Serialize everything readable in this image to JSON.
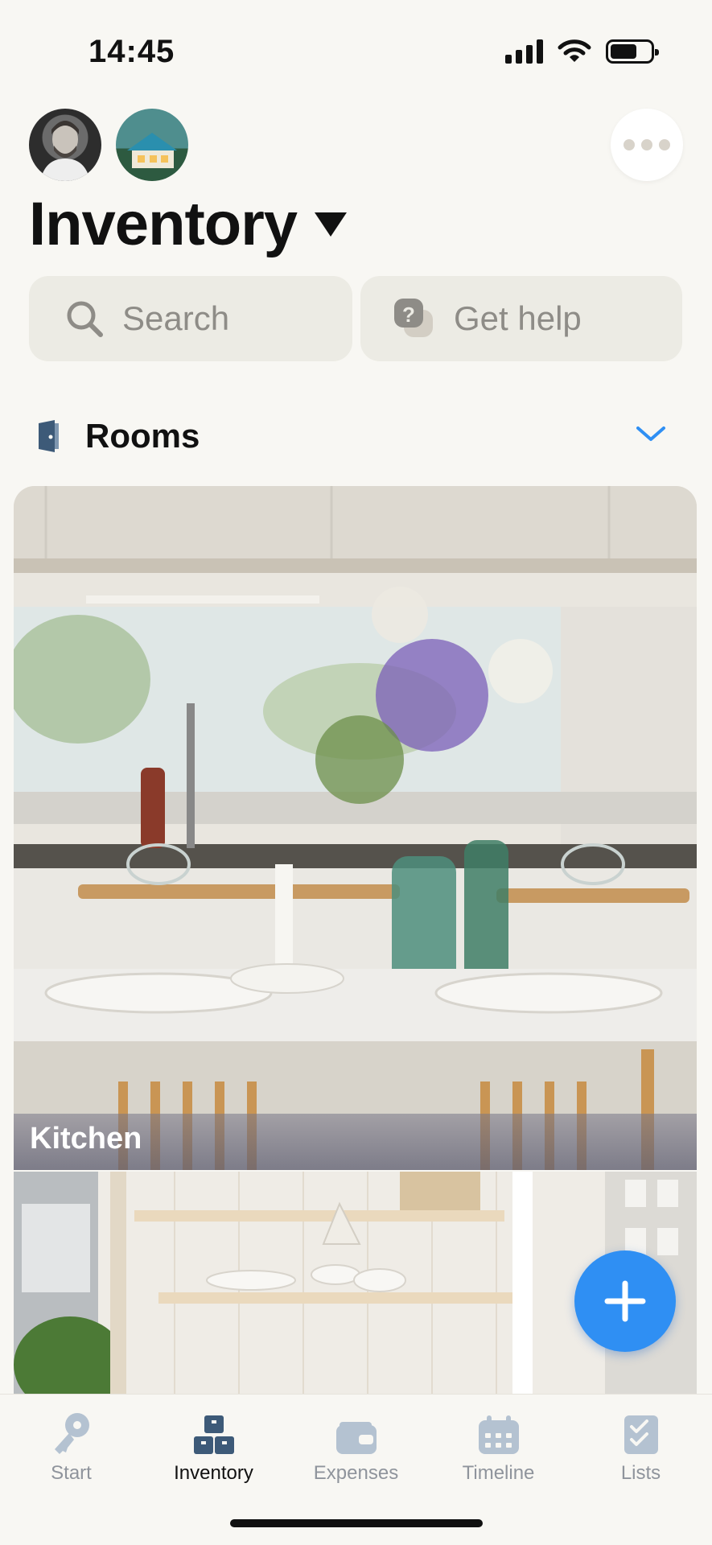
{
  "status_bar": {
    "time": "14:45"
  },
  "header": {
    "title": "Inventory",
    "more_icon": "ellipsis-icon"
  },
  "actions": {
    "search_label": "Search",
    "help_label": "Get help"
  },
  "rooms": {
    "section_label": "Rooms",
    "items": [
      {
        "name": "Kitchen"
      },
      {
        "name": ""
      }
    ]
  },
  "fab": {
    "icon": "plus-icon"
  },
  "tab_bar": {
    "active": "Inventory",
    "items": [
      {
        "label": "Start",
        "icon": "key-icon"
      },
      {
        "label": "Inventory",
        "icon": "boxes-icon"
      },
      {
        "label": "Expenses",
        "icon": "wallet-icon"
      },
      {
        "label": "Timeline",
        "icon": "calendar-icon"
      },
      {
        "label": "Lists",
        "icon": "checklist-icon"
      }
    ]
  },
  "colors": {
    "accent": "#2f8ff3",
    "background": "#f8f7f3",
    "tab_active": "#3d5a78",
    "tab_inactive": "#8f949c"
  }
}
